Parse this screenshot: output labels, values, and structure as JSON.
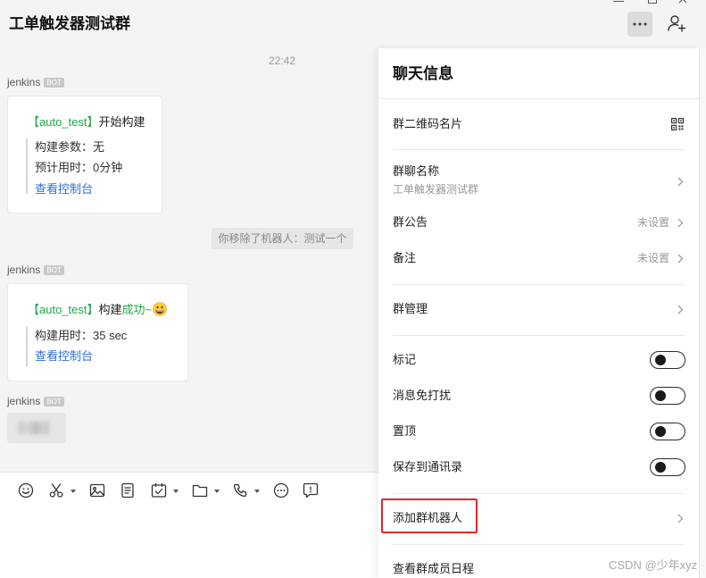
{
  "window": {
    "title": "工单触发器测试群",
    "controls": [
      "minimize-icon",
      "maximize-icon",
      "close-icon"
    ]
  },
  "header": {
    "icons": {
      "more": "more-icon",
      "add_member": "add-member-icon"
    }
  },
  "chat": {
    "time": "22:42",
    "messages": [
      {
        "sender": "jenkins",
        "badge": "BOT",
        "card": {
          "tag": "【auto_test】",
          "text": "开始构建",
          "rows": [
            "构建参数：无",
            "预计用时：0分钟"
          ],
          "link": "查看控制台"
        }
      },
      {
        "system": "你移除了机器人：测试一个"
      },
      {
        "sender": "jenkins",
        "badge": "BOT",
        "card": {
          "tag": "【auto_test】",
          "text": "构建",
          "highlight": "成功~",
          "emoji": "grinning-face-icon",
          "rows": [
            "构建用时：35 sec"
          ],
          "link": "查看控制台"
        }
      },
      {
        "sender": "jenkins",
        "badge": "BOT"
      }
    ]
  },
  "input_toolbar": {
    "icons": [
      "emoji-icon",
      "screenshot-icon",
      "image-icon",
      "note-icon",
      "schedule-icon",
      "folder-icon",
      "phone-icon",
      "more-circle-icon",
      "feedback-icon"
    ]
  },
  "info_panel": {
    "title": "聊天信息",
    "qr_card": {
      "label": "群二维码名片",
      "icon": "qr-code-icon"
    },
    "group_name": {
      "label": "群聊名称",
      "value": "工单触发器测试群"
    },
    "announcement": {
      "label": "群公告",
      "value": "未设置"
    },
    "remark": {
      "label": "备注",
      "value": "未设置"
    },
    "manage": {
      "label": "群管理"
    },
    "toggles": [
      {
        "label": "标记",
        "on": false
      },
      {
        "label": "消息免打扰",
        "on": false
      },
      {
        "label": "置顶",
        "on": false
      },
      {
        "label": "保存到通讯录",
        "on": false
      }
    ],
    "add_bot": {
      "label": "添加群机器人"
    },
    "member_schedule": {
      "label": "查看群成员日程"
    }
  },
  "watermark": {
    "text": "CSDN @少年xyz"
  },
  "colors": {
    "accent_green": "#20a849",
    "link_blue": "#2b6fd6",
    "highlight_red": "#e0282a",
    "chat_bg": "#f4f4f4"
  }
}
